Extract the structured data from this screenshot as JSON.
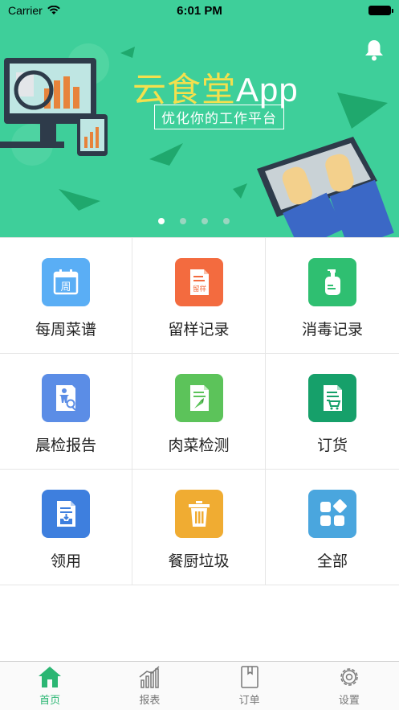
{
  "status_bar": {
    "carrier": "Carrier",
    "time": "6:01 PM"
  },
  "banner": {
    "title_cn": "云食堂",
    "title_en": "App",
    "subtitle": "优化你的工作平台",
    "page_count": 4,
    "active_page": 1
  },
  "grid": {
    "items": [
      {
        "label": "每周菜谱",
        "icon": "calendar-week-icon",
        "color": "#5aaef5",
        "glyph": "周"
      },
      {
        "label": "留样记录",
        "icon": "sample-document-icon",
        "color": "#f36b3f",
        "glyph": "留样"
      },
      {
        "label": "消毒记录",
        "icon": "sanitizer-bottle-icon",
        "color": "#2fbf71"
      },
      {
        "label": "晨检报告",
        "icon": "person-inspection-icon",
        "color": "#5b8de6"
      },
      {
        "label": "肉菜检测",
        "icon": "vegetable-report-icon",
        "color": "#5cc35a"
      },
      {
        "label": "订货",
        "icon": "order-cart-icon",
        "color": "#16a06a"
      },
      {
        "label": "领用",
        "icon": "receive-document-icon",
        "color": "#3e7fde"
      },
      {
        "label": "餐厨垃圾",
        "icon": "trash-bin-icon",
        "color": "#f0ac32"
      },
      {
        "label": "全部",
        "icon": "all-apps-icon",
        "color": "#4aa6de"
      }
    ]
  },
  "tabbar": {
    "tabs": [
      {
        "label": "首页",
        "icon": "home-icon",
        "active": true
      },
      {
        "label": "报表",
        "icon": "chart-icon",
        "active": false
      },
      {
        "label": "订单",
        "icon": "order-book-icon",
        "active": false
      },
      {
        "label": "设置",
        "icon": "gear-icon",
        "active": false
      }
    ],
    "active_color": "#2bb673"
  },
  "colors": {
    "banner": "#3ecf9a"
  }
}
